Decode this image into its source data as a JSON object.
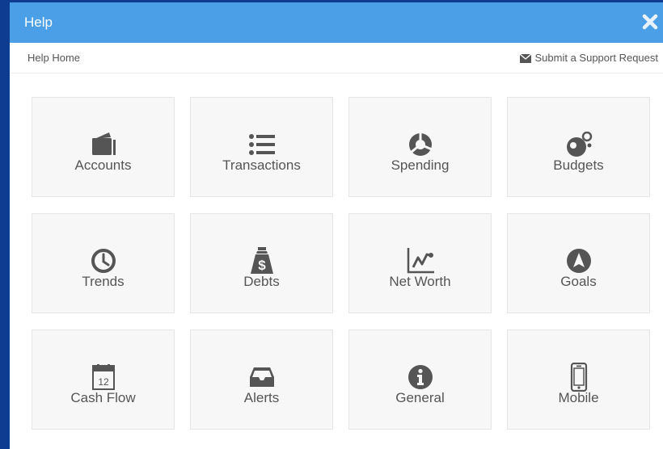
{
  "window": {
    "title": "Help"
  },
  "nav": {
    "home": "Help Home",
    "support": "Submit a Support Request"
  },
  "tiles": [
    {
      "label": "Accounts",
      "icon": "wallet-icon"
    },
    {
      "label": "Transactions",
      "icon": "list-icon"
    },
    {
      "label": "Spending",
      "icon": "pie-chart-icon"
    },
    {
      "label": "Budgets",
      "icon": "budget-circles-icon"
    },
    {
      "label": "Trends",
      "icon": "clock-icon"
    },
    {
      "label": "Debts",
      "icon": "money-bag-icon"
    },
    {
      "label": "Net Worth",
      "icon": "line-chart-icon"
    },
    {
      "label": "Goals",
      "icon": "compass-icon"
    },
    {
      "label": "Cash Flow",
      "icon": "calendar-icon"
    },
    {
      "label": "Alerts",
      "icon": "inbox-icon"
    },
    {
      "label": "General",
      "icon": "info-icon"
    },
    {
      "label": "Mobile",
      "icon": "phone-icon"
    }
  ],
  "calendar_day": "12",
  "colors": {
    "titlebar": "#4a9fe6",
    "frame": "#0d3c91",
    "icon": "#555555",
    "tile_bg": "#f7f7f7"
  }
}
